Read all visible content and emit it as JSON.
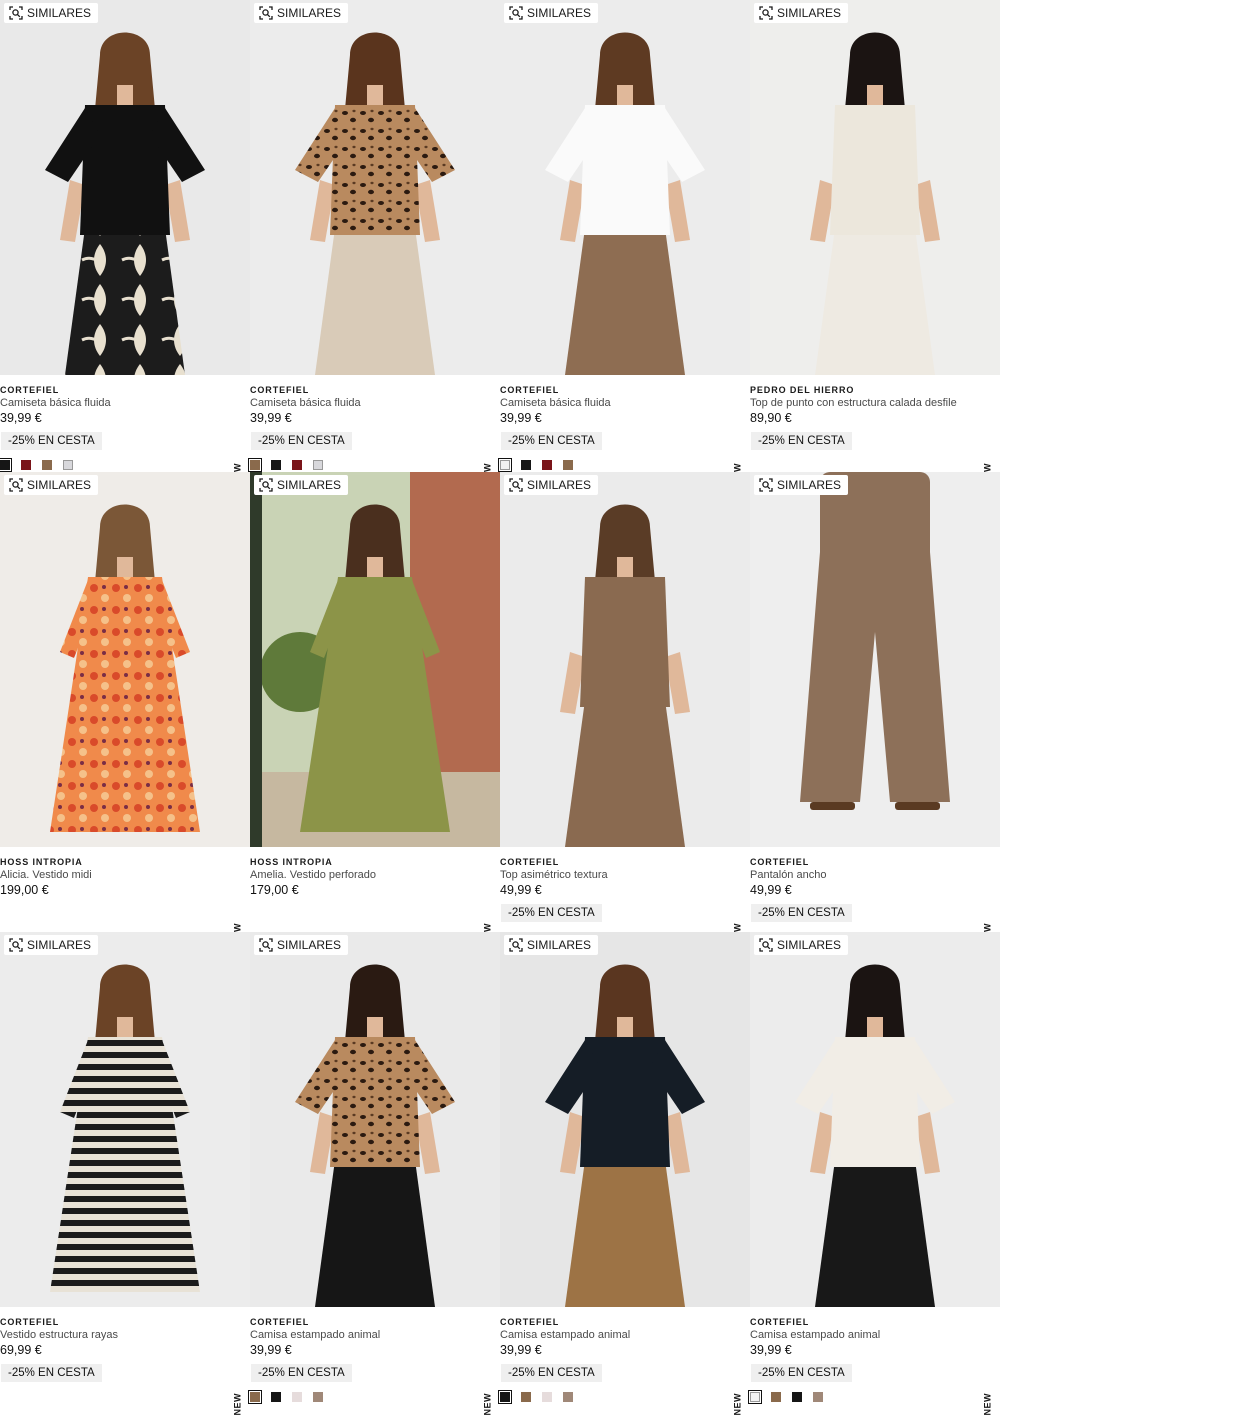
{
  "similar_label": "SIMILARES",
  "new_label": "NEW",
  "colors": {
    "black": "#161616",
    "burgundy": "#7a1419",
    "leopard": "#8a6a4c",
    "light_gray": "#d8d8dc",
    "white": "#f2f2f2",
    "pink_gray": "#e6dcdc",
    "taupe": "#a08878",
    "promo_bg": "#efefef"
  },
  "products": [
    {
      "brand": "CORTEFIEL",
      "name": "Camiseta básica fluida",
      "price": "39,99 €",
      "promo": "-25% EN CESTA",
      "swatches": [
        "black",
        "burgundy",
        "leopard",
        "light_gray"
      ]
    },
    {
      "brand": "CORTEFIEL",
      "name": "Camiseta básica fluida",
      "price": "39,99 €",
      "promo": "-25% EN CESTA",
      "swatches": [
        "leopard",
        "black",
        "burgundy",
        "light_gray"
      ]
    },
    {
      "brand": "CORTEFIEL",
      "name": "Camiseta básica fluida",
      "price": "39,99 €",
      "promo": "-25% EN CESTA",
      "swatches": [
        "white",
        "black",
        "burgundy",
        "leopard"
      ]
    },
    {
      "brand": "PEDRO DEL HIERRO",
      "name": "Top de punto con estructura calada desfile",
      "price": "89,90 €",
      "promo": "-25% EN CESTA",
      "swatches": []
    },
    {
      "brand": "HOSS INTROPIA",
      "name": "Alicia. Vestido midi",
      "price": "199,00 €",
      "promo": "",
      "swatches": []
    },
    {
      "brand": "HOSS INTROPIA",
      "name": "Amelia. Vestido perforado",
      "price": "179,00 €",
      "promo": "",
      "swatches": []
    },
    {
      "brand": "CORTEFIEL",
      "name": "Top asimétrico textura",
      "price": "49,99 €",
      "promo": "-25% EN CESTA",
      "swatches": []
    },
    {
      "brand": "CORTEFIEL",
      "name": "Pantalón ancho",
      "price": "49,99 €",
      "promo": "-25% EN CESTA",
      "swatches": []
    },
    {
      "brand": "CORTEFIEL",
      "name": "Vestido estructura rayas",
      "price": "69,99 €",
      "promo": "-25% EN CESTA",
      "swatches": []
    },
    {
      "brand": "CORTEFIEL",
      "name": "Camisa estampado animal",
      "price": "39,99 €",
      "promo": "-25% EN CESTA",
      "swatches": [
        "leopard",
        "black",
        "pink_gray",
        "taupe"
      ]
    },
    {
      "brand": "CORTEFIEL",
      "name": "Camisa estampado animal",
      "price": "39,99 €",
      "promo": "-25% EN CESTA",
      "swatches": [
        "black",
        "leopard",
        "pink_gray",
        "taupe"
      ]
    },
    {
      "brand": "CORTEFIEL",
      "name": "Camisa estampado animal",
      "price": "39,99 €",
      "promo": "-25% EN CESTA",
      "swatches": [
        "white",
        "leopard",
        "black",
        "taupe"
      ]
    }
  ]
}
